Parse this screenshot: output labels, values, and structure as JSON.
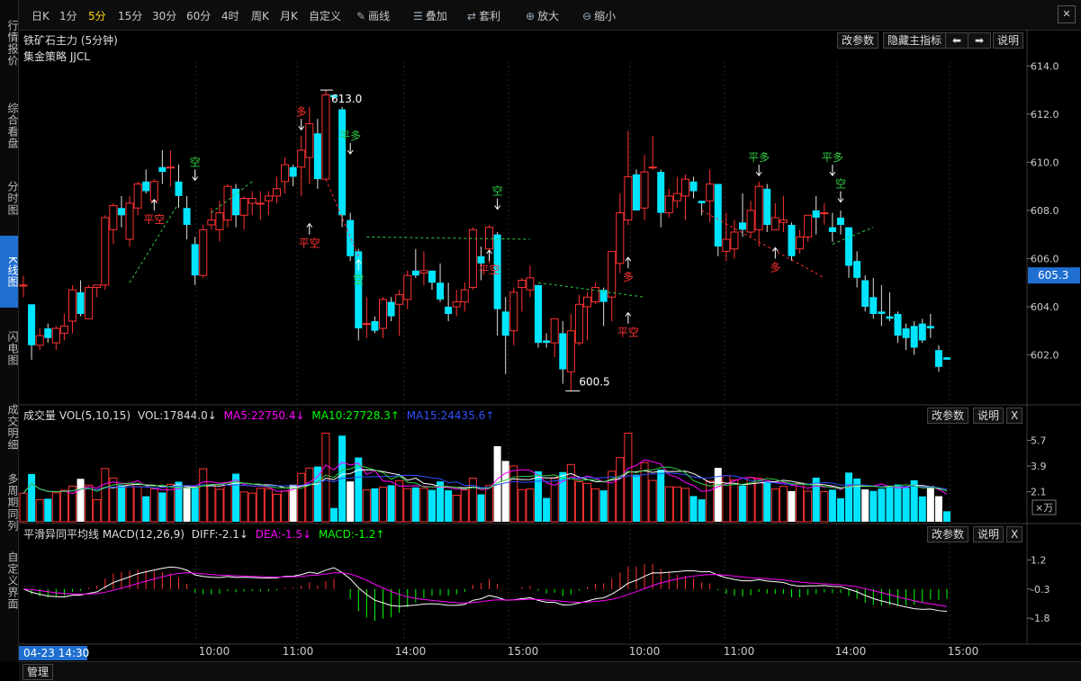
{
  "sidebar": {
    "items": [
      {
        "label": "行情报价",
        "active": false
      },
      {
        "label": "综合看盘",
        "active": false
      },
      {
        "label": "分时图",
        "active": false
      },
      {
        "label": "K线图",
        "active": true
      },
      {
        "label": "闪电图",
        "active": false
      },
      {
        "label": "成交明细",
        "active": false
      },
      {
        "label": "多周期同列",
        "active": false
      },
      {
        "label": "自定义界面",
        "active": false
      }
    ]
  },
  "toolbar": {
    "periods": [
      "日K",
      "1分",
      "5分",
      "15分",
      "30分",
      "60分",
      "4时",
      "周K",
      "月K",
      "自定义"
    ],
    "active_period": "5分",
    "tools": [
      {
        "label": "画线",
        "icon": "pencil-icon"
      },
      {
        "label": "叠加",
        "icon": "stack-icon"
      },
      {
        "label": "套利",
        "icon": "arbitrage-icon"
      },
      {
        "label": "放大",
        "icon": "zoom-in-icon"
      },
      {
        "label": "缩小",
        "icon": "zoom-out-icon"
      }
    ],
    "close_label": "✕"
  },
  "main_panel": {
    "instrument": "铁矿石主力 (5分钟)",
    "strategy": "集金策略 JJCL",
    "buttons": {
      "params": "改参数",
      "hide": "隐藏主指标",
      "left": "⬅",
      "right": "➡",
      "help": "说明"
    },
    "y_axis": [
      "614.0",
      "612.0",
      "610.0",
      "608.0",
      "606.0",
      "604.0",
      "602.0"
    ],
    "current_price": "605.3",
    "high_label": "613.0",
    "low_label": "600.5",
    "signals": {
      "short": "空",
      "long": "多",
      "close_short": "平空",
      "close_long": "平多"
    }
  },
  "volume_panel": {
    "title": "成交量 VOL(5,10,15)",
    "vol": "VOL:17844.0↓",
    "ma5": "MA5:22750.4↓",
    "ma10": "MA10:27728.3↑",
    "ma15": "MA15:24435.6↑",
    "buttons": {
      "params": "改参数",
      "help": "说明",
      "close": "X"
    },
    "y_axis": [
      "5.7",
      "3.9",
      "2.1"
    ],
    "unit": "×万"
  },
  "macd_panel": {
    "title": "平滑异同平均线 MACD(12,26,9)",
    "diff": "DIFF:-2.1↓",
    "dea": "DEA:-1.5↓",
    "macd": "MACD:-1.2↑",
    "buttons": {
      "params": "改参数",
      "help": "说明",
      "close": "X"
    },
    "y_axis": [
      "1.2",
      "-0.3",
      "-1.8"
    ]
  },
  "time_axis": {
    "cursor": "04-23 14:30",
    "labels": [
      "10:00",
      "11:00",
      "14:00",
      "15:00",
      "10:00",
      "11:00",
      "14:00",
      "15:00"
    ]
  },
  "bottom_bar": {
    "manage": "管理"
  },
  "colors": {
    "up": "#ff3232",
    "down": "#00e5ff",
    "ma5": "#ff00ff",
    "ma10": "#00ff00",
    "ma15": "#3050ff",
    "active_tab": "#1f6fd1"
  },
  "chart_data": {
    "type": "candlestick",
    "y_range": [
      600.0,
      614.2
    ],
    "candles": [
      [
        604.9,
        605.3,
        604.4,
        604.9
      ],
      [
        604.1,
        604.1,
        601.8,
        602.4
      ],
      [
        602.4,
        603.1,
        602.2,
        602.8
      ],
      [
        603.1,
        603.3,
        602.5,
        602.7
      ],
      [
        602.5,
        603.2,
        602.2,
        603.1
      ],
      [
        602.9,
        603.7,
        602.6,
        603.2
      ],
      [
        603.4,
        604.9,
        602.9,
        604.7
      ],
      [
        604.6,
        605.1,
        603.6,
        603.7
      ],
      [
        603.5,
        604.9,
        603.5,
        604.8
      ],
      [
        604.8,
        604.9,
        604.4,
        604.9
      ],
      [
        604.9,
        607.8,
        604.7,
        607.7
      ],
      [
        607.2,
        608.3,
        606.6,
        608.2
      ],
      [
        608.1,
        608.6,
        607.3,
        607.8
      ],
      [
        606.8,
        608.6,
        606.5,
        608.3
      ],
      [
        608.1,
        609.2,
        607.8,
        609.1
      ],
      [
        609.2,
        609.7,
        608.7,
        608.8
      ],
      [
        608.4,
        609.3,
        608.3,
        609.2
      ],
      [
        609.8,
        610.5,
        609.1,
        609.6
      ],
      [
        609.8,
        610.5,
        609.0,
        609.8
      ],
      [
        609.2,
        609.9,
        608.1,
        608.6
      ],
      [
        608.1,
        608.6,
        606.8,
        607.4
      ],
      [
        606.6,
        606.9,
        604.9,
        605.3
      ],
      [
        605.3,
        607.4,
        605.2,
        607.2
      ],
      [
        607.4,
        608.1,
        607.2,
        607.6
      ],
      [
        607.2,
        608.4,
        606.7,
        607.9
      ],
      [
        607.6,
        609.1,
        607.3,
        609.0
      ],
      [
        608.9,
        609.1,
        607.3,
        607.8
      ],
      [
        607.8,
        608.6,
        607.2,
        608.5
      ],
      [
        608.3,
        608.8,
        607.8,
        608.5
      ],
      [
        608.3,
        608.8,
        607.6,
        608.3
      ],
      [
        608.4,
        608.8,
        607.8,
        608.6
      ],
      [
        608.6,
        609.4,
        608.3,
        608.9
      ],
      [
        609.2,
        610.2,
        608.7,
        609.9
      ],
      [
        609.8,
        609.9,
        609.0,
        609.4
      ],
      [
        609.8,
        611.1,
        608.6,
        610.5
      ],
      [
        610.2,
        612.3,
        609.1,
        611.6
      ],
      [
        611.2,
        611.8,
        608.9,
        609.3
      ],
      [
        609.3,
        613.0,
        609.3,
        612.8
      ],
      [
        612.8,
        612.8,
        612.6,
        612.7
      ],
      [
        612.2,
        612.3,
        607.3,
        607.8
      ],
      [
        607.6,
        607.9,
        605.9,
        606.1
      ],
      [
        606.3,
        606.4,
        602.6,
        603.1
      ],
      [
        603.3,
        604.4,
        602.7,
        603.3
      ],
      [
        603.4,
        603.6,
        602.9,
        603.0
      ],
      [
        603.1,
        604.4,
        602.7,
        604.3
      ],
      [
        604.2,
        604.4,
        603.4,
        603.6
      ],
      [
        604.1,
        604.7,
        602.8,
        604.5
      ],
      [
        604.3,
        605.5,
        603.9,
        605.3
      ],
      [
        605.5,
        606.4,
        605.2,
        605.3
      ],
      [
        605.4,
        606.3,
        604.9,
        605.5
      ],
      [
        605.5,
        605.5,
        604.7,
        605.0
      ],
      [
        605.0,
        605.8,
        604.2,
        604.3
      ],
      [
        604.0,
        605.0,
        603.4,
        603.7
      ],
      [
        604.0,
        604.7,
        603.6,
        604.2
      ],
      [
        604.2,
        605.0,
        603.8,
        604.7
      ],
      [
        604.8,
        607.3,
        604.7,
        607.2
      ],
      [
        606.1,
        606.5,
        605.1,
        605.8
      ],
      [
        606.4,
        607.4,
        605.8,
        607.3
      ],
      [
        607.0,
        607.1,
        602.8,
        603.9
      ],
      [
        603.8,
        604.4,
        601.2,
        602.8
      ],
      [
        603.0,
        604.8,
        602.4,
        604.6
      ],
      [
        604.8,
        605.2,
        603.8,
        605.1
      ],
      [
        604.7,
        605.7,
        604.4,
        605.2
      ],
      [
        604.9,
        604.9,
        602.3,
        602.5
      ],
      [
        602.6,
        602.9,
        602.3,
        602.5
      ],
      [
        602.5,
        603.5,
        601.9,
        603.5
      ],
      [
        602.9,
        603.4,
        600.8,
        601.4
      ],
      [
        601.3,
        603.7,
        600.5,
        603.0
      ],
      [
        602.5,
        604.5,
        602.4,
        604.1
      ],
      [
        604.0,
        604.6,
        602.6,
        604.4
      ],
      [
        604.2,
        605.0,
        604.1,
        604.8
      ],
      [
        604.7,
        604.8,
        603.2,
        604.2
      ],
      [
        604.4,
        606.3,
        603.4,
        606.3
      ],
      [
        605.8,
        608.7,
        605.4,
        607.9
      ],
      [
        607.6,
        611.3,
        607.4,
        609.4
      ],
      [
        609.5,
        609.7,
        608.0,
        608.0
      ],
      [
        608.1,
        610.3,
        607.6,
        609.6
      ],
      [
        609.8,
        611.1,
        609.7,
        609.8
      ],
      [
        609.6,
        609.7,
        607.3,
        607.9
      ],
      [
        607.9,
        608.9,
        607.7,
        608.6
      ],
      [
        608.4,
        609.4,
        608.1,
        608.7
      ],
      [
        608.6,
        609.5,
        607.6,
        609.3
      ],
      [
        609.2,
        609.4,
        608.5,
        608.8
      ],
      [
        608.4,
        608.4,
        607.8,
        608.3
      ],
      [
        608.4,
        609.7,
        607.5,
        609.1
      ],
      [
        609.1,
        609.1,
        606.1,
        606.5
      ],
      [
        606.3,
        607.9,
        605.9,
        606.8
      ],
      [
        606.4,
        607.6,
        606.0,
        607.1
      ],
      [
        607.5,
        608.7,
        606.9,
        607.2
      ],
      [
        607.1,
        608.4,
        606.9,
        608.0
      ],
      [
        607.2,
        609.2,
        606.5,
        609.0
      ],
      [
        608.9,
        609.1,
        607.1,
        607.4
      ],
      [
        607.2,
        608.3,
        607.2,
        607.7
      ],
      [
        607.5,
        608.6,
        607.1,
        607.6
      ],
      [
        607.4,
        607.5,
        605.9,
        606.1
      ],
      [
        606.4,
        607.2,
        606.2,
        606.9
      ],
      [
        606.9,
        607.8,
        606.7,
        607.8
      ],
      [
        608.0,
        608.6,
        607.0,
        607.7
      ],
      [
        607.9,
        608.3,
        607.4,
        607.9
      ],
      [
        607.3,
        607.9,
        606.7,
        607.1
      ],
      [
        607.7,
        608.0,
        607.0,
        607.4
      ],
      [
        607.3,
        607.3,
        605.2,
        605.7
      ],
      [
        605.9,
        606.3,
        604.8,
        605.2
      ],
      [
        605.1,
        605.3,
        603.8,
        604.0
      ],
      [
        604.4,
        605.2,
        603.5,
        603.7
      ],
      [
        603.8,
        604.9,
        603.2,
        603.7
      ],
      [
        603.6,
        604.6,
        603.4,
        603.5
      ],
      [
        603.7,
        603.8,
        602.5,
        602.8
      ],
      [
        603.1,
        603.3,
        602.2,
        602.7
      ],
      [
        603.2,
        603.4,
        602.0,
        602.3
      ],
      [
        603.3,
        603.5,
        602.5,
        602.6
      ],
      [
        603.2,
        603.7,
        602.7,
        603.1
      ],
      [
        602.2,
        602.4,
        601.3,
        601.5
      ],
      [
        601.9,
        601.9,
        601.8,
        601.8
      ]
    ]
  }
}
